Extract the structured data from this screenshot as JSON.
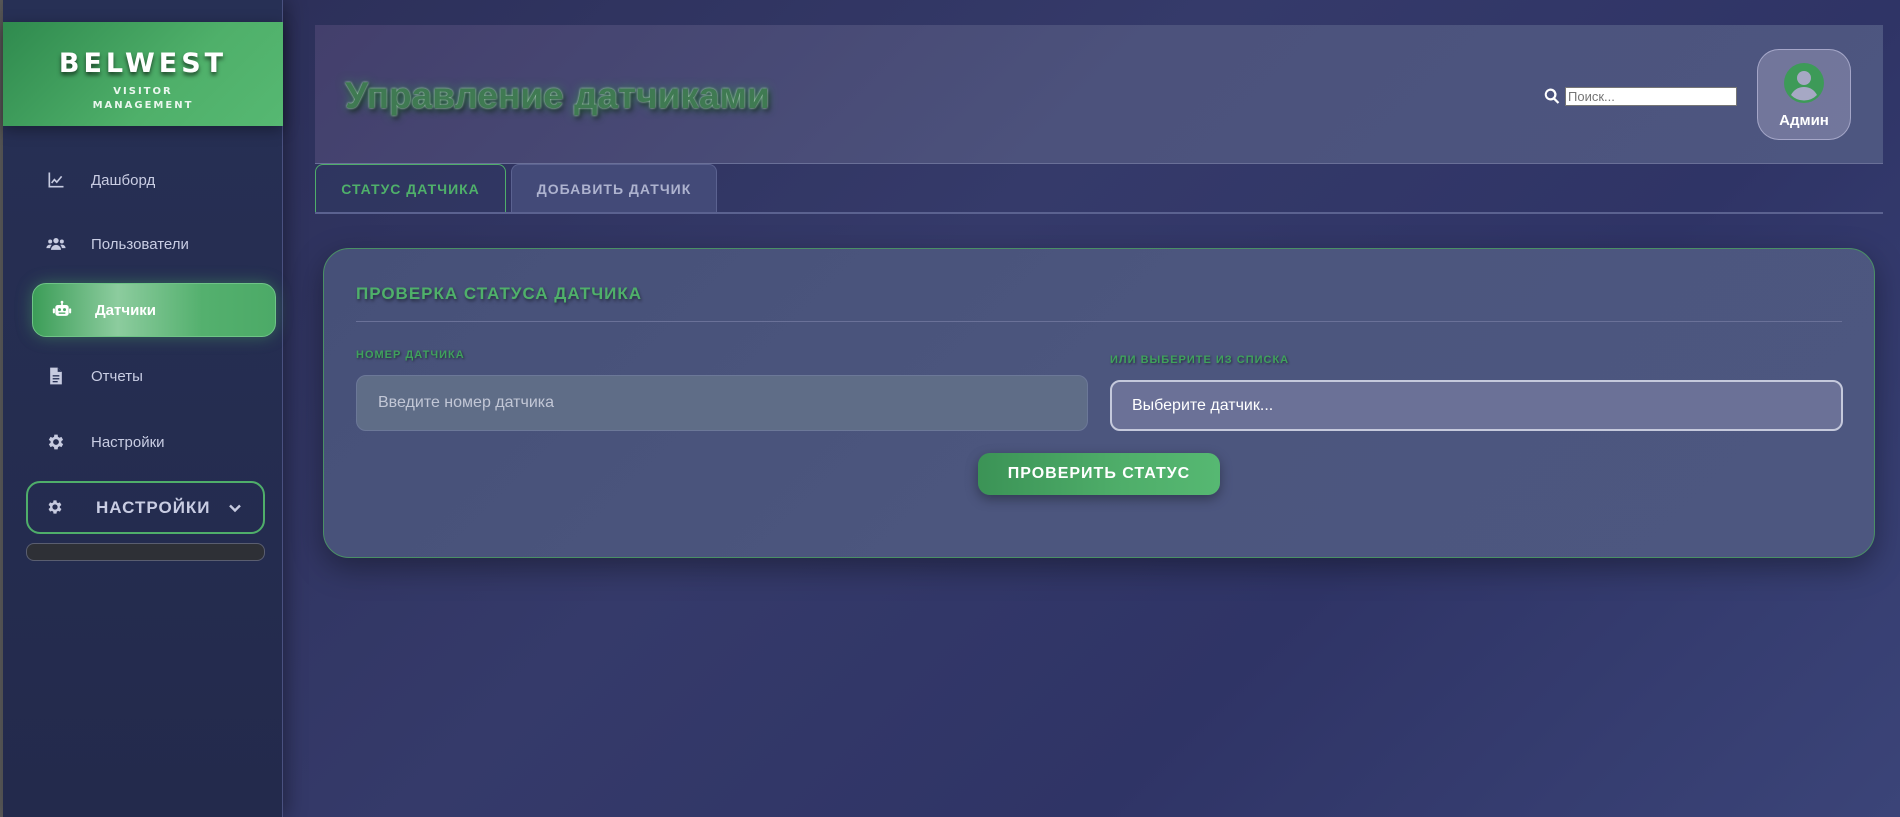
{
  "brand": {
    "title": "BELWEST",
    "subtitle_line1": "VISITOR",
    "subtitle_line2": "MANAGEMENT"
  },
  "sidebar": {
    "items": [
      {
        "label": "Дашборд",
        "icon": "chart-line-icon"
      },
      {
        "label": "Пользователи",
        "icon": "users-icon"
      },
      {
        "label": "Датчики",
        "icon": "robot-icon",
        "active": true
      },
      {
        "label": "Отчеты",
        "icon": "file-icon"
      },
      {
        "label": "Настройки",
        "icon": "gear-icon"
      }
    ],
    "settings_dropdown": {
      "label": "НАСТРОЙКИ",
      "icon": "gear-icon",
      "chevron": "chevron-down-icon"
    }
  },
  "header": {
    "title": "Управление датчиками",
    "search": {
      "placeholder": "Поиск...",
      "value": ""
    },
    "user": {
      "label": "Админ",
      "icon": "user-circle-icon"
    }
  },
  "tabs": [
    {
      "label": "СТАТУС ДАТЧИКА",
      "active": true
    },
    {
      "label": "ДОБАВИТЬ ДАТЧИК",
      "active": false
    }
  ],
  "card": {
    "title": "ПРОВЕРКА СТАТУСА ДАТЧИКА",
    "sensor_number": {
      "label": "НОМЕР ДАТЧИКА",
      "placeholder": "Введите номер датчика",
      "value": ""
    },
    "sensor_select": {
      "label": "ИЛИ ВЫБЕРИТЕ ИЗ СПИСКА",
      "selected": "Выберите датчик..."
    },
    "button": "ПРОВЕРИТЬ СТАТУС"
  },
  "colors": {
    "accent": "#4fb06a",
    "background": "#2f3466",
    "sidebar": "#273055"
  }
}
